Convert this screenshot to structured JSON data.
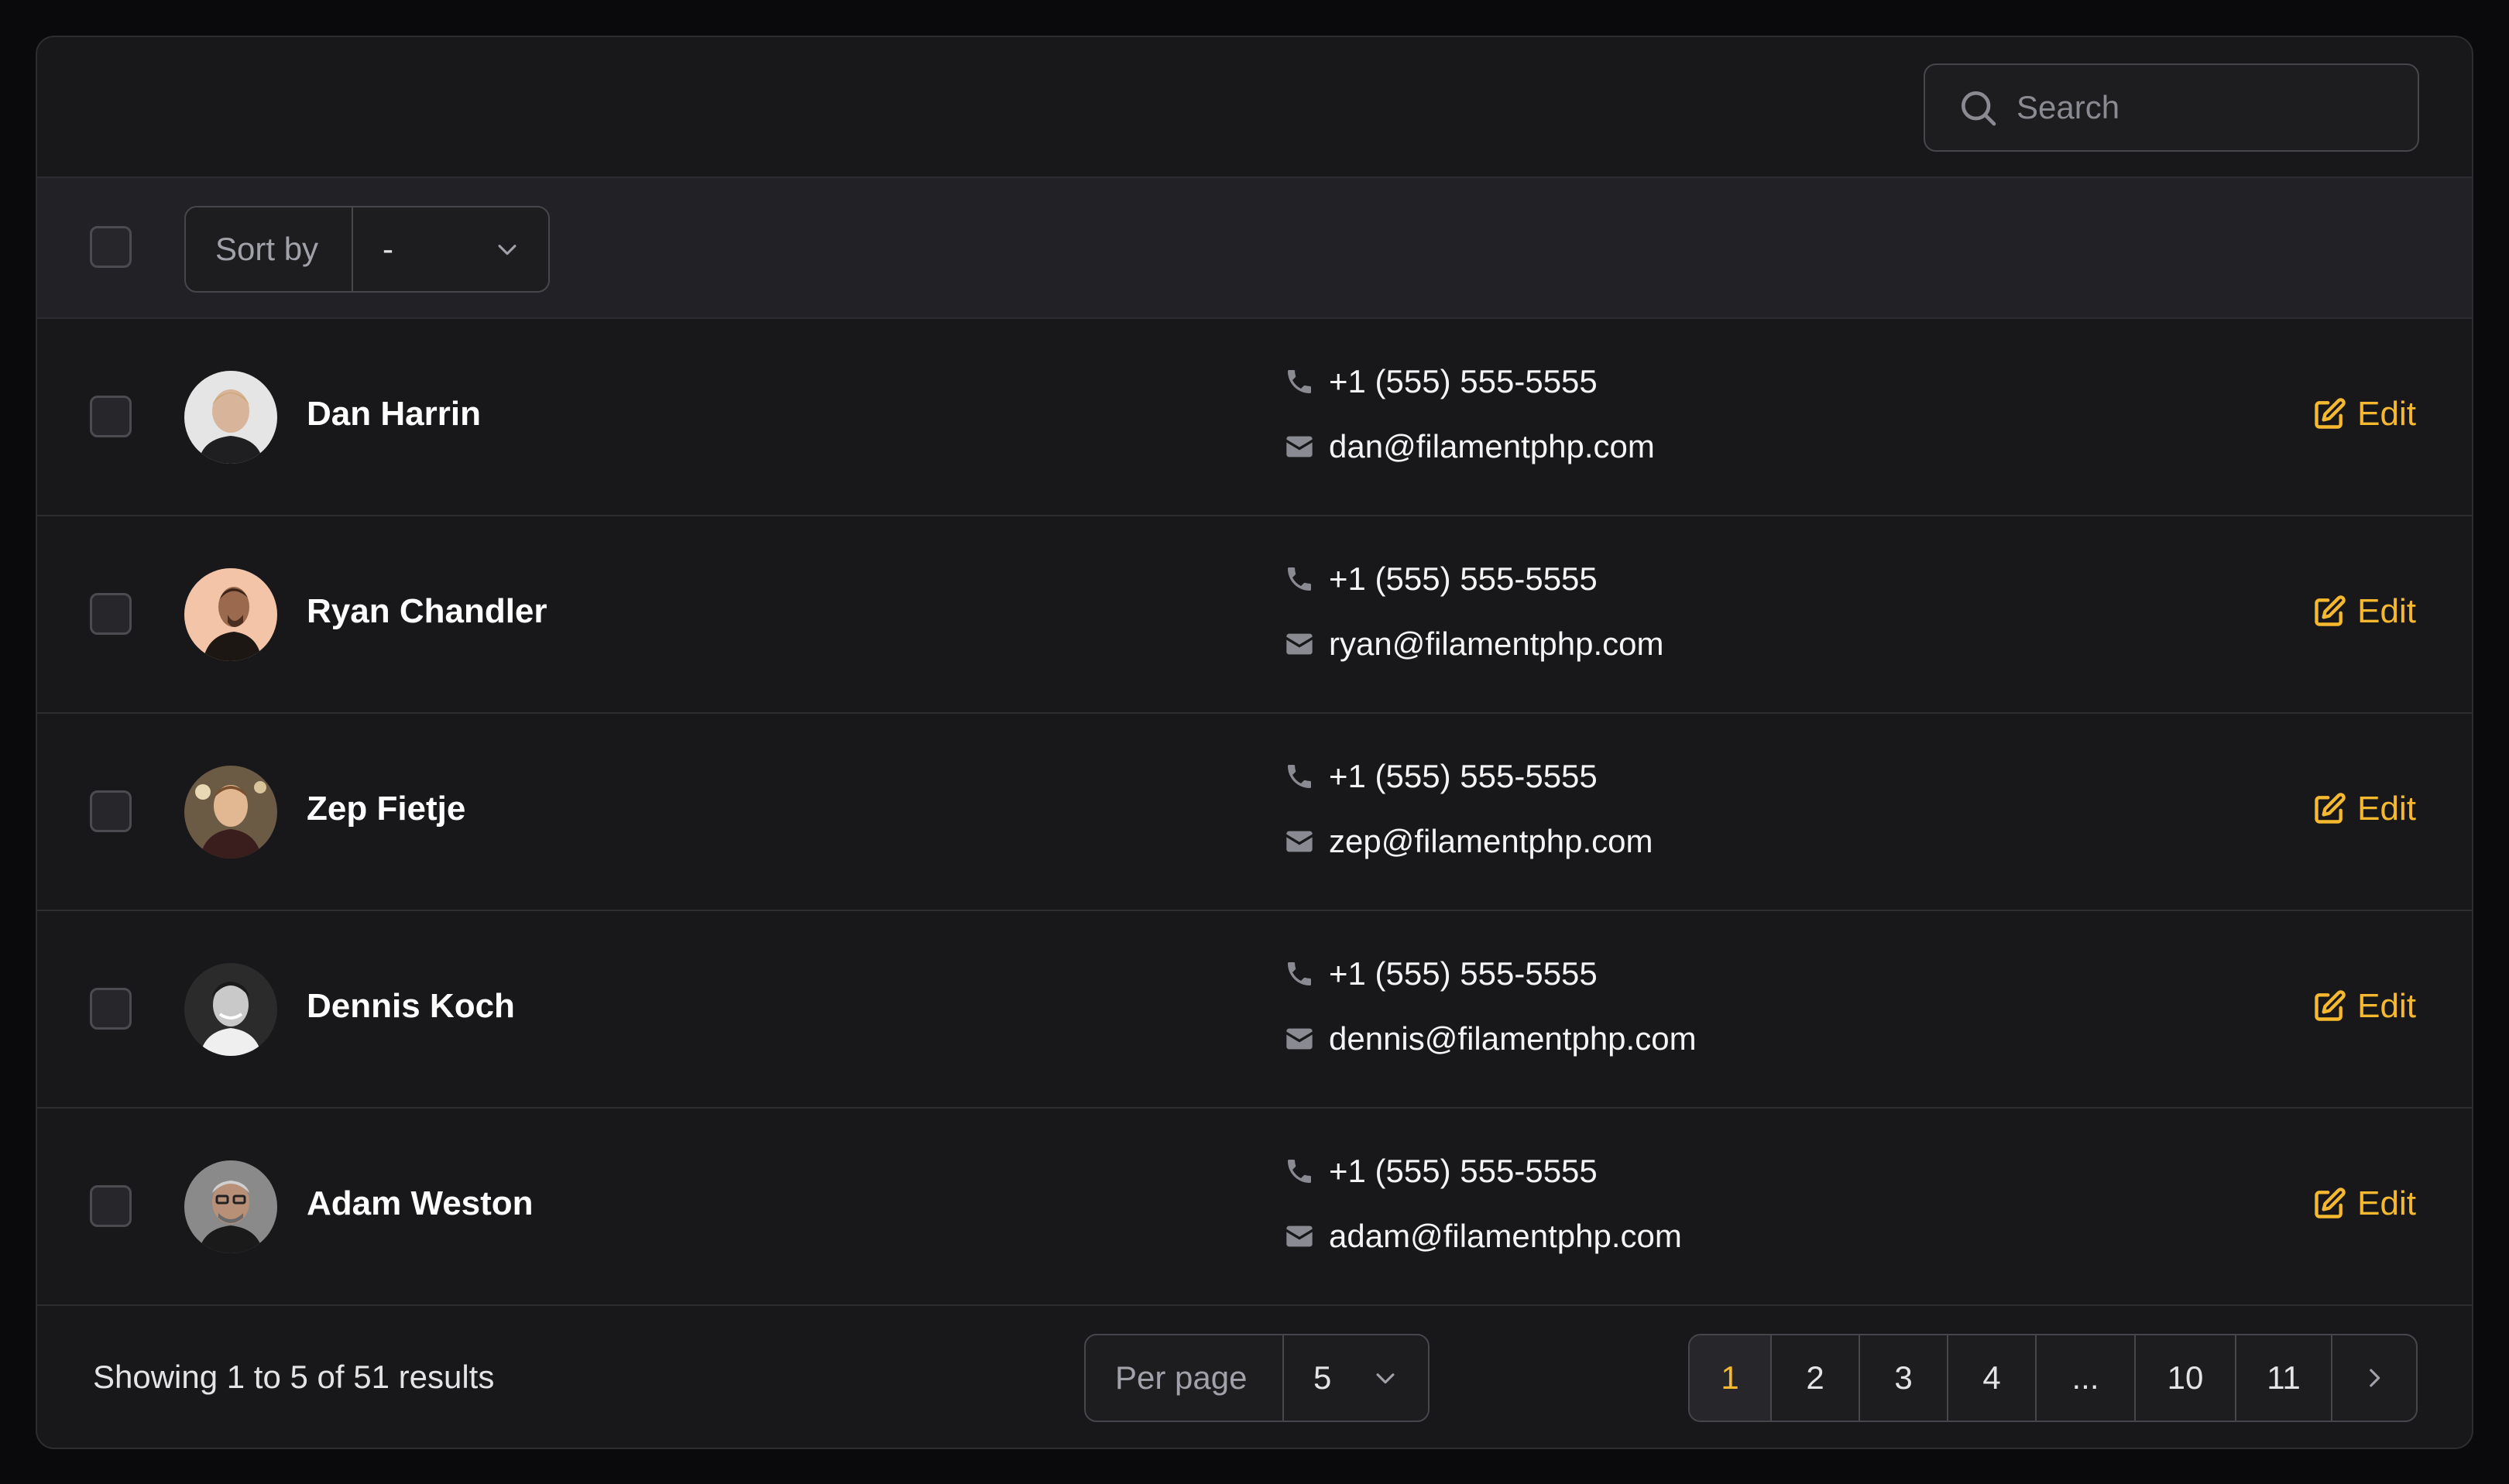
{
  "search": {
    "placeholder": "Search"
  },
  "toolbar": {
    "sort_label": "Sort by",
    "sort_value": "-"
  },
  "rows": [
    {
      "name": "Dan Harrin",
      "phone": "+1 (555) 555-5555",
      "email": "dan@filamentphp.com",
      "edit": "Edit"
    },
    {
      "name": "Ryan Chandler",
      "phone": "+1 (555) 555-5555",
      "email": "ryan@filamentphp.com",
      "edit": "Edit"
    },
    {
      "name": "Zep Fietje",
      "phone": "+1 (555) 555-5555",
      "email": "zep@filamentphp.com",
      "edit": "Edit"
    },
    {
      "name": "Dennis Koch",
      "phone": "+1 (555) 555-5555",
      "email": "dennis@filamentphp.com",
      "edit": "Edit"
    },
    {
      "name": "Adam Weston",
      "phone": "+1 (555) 555-5555",
      "email": "adam@filamentphp.com",
      "edit": "Edit"
    }
  ],
  "footer": {
    "showing": "Showing 1 to 5 of 51 results",
    "per_page_label": "Per page",
    "per_page_value": "5",
    "pages": [
      "1",
      "2",
      "3",
      "4",
      "...",
      "10",
      "11"
    ],
    "current_page": "1"
  },
  "colors": {
    "accent": "#f5b82e",
    "background": "#18181b",
    "border": "#2c2c31"
  },
  "icons": {
    "search": "search-icon",
    "chevron": "chevron-down-icon",
    "phone": "phone-icon",
    "email": "envelope-icon",
    "edit": "pencil-square-icon",
    "next": "chevron-right-icon"
  }
}
